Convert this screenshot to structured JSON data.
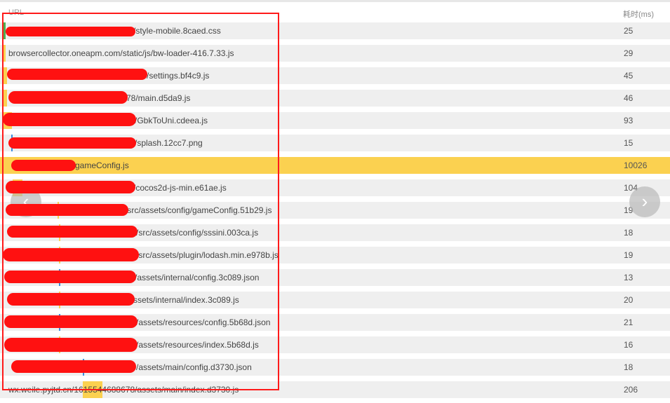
{
  "header": {
    "url_label": "URL",
    "time_label": "耗时(ms)"
  },
  "rows": [
    {
      "url": "/style-mobile.8caed.css",
      "ms": "25"
    },
    {
      "url": "browsercollector.oneapm.com/static/js/bw-loader-416.7.33.js",
      "ms": "29"
    },
    {
      "url": "/settings.bf4c9.js",
      "ms": "45"
    },
    {
      "url": "78/main.d5da9.js",
      "ms": "46"
    },
    {
      "url": "/GbkToUni.cdeea.js",
      "ms": "93"
    },
    {
      "url": "/splash.12cc7.png",
      "ms": "15"
    },
    {
      "url": "gameConfig.js",
      "ms": "10026"
    },
    {
      "url": "/cocos2d-js-min.e61ae.js",
      "ms": "104"
    },
    {
      "url": "/src/assets/config/gameConfig.51b29.js",
      "ms": "19"
    },
    {
      "url": "/src/assets/config/sssini.003ca.js",
      "ms": "18"
    },
    {
      "url": "/src/assets/plugin/lodash.min.e978b.js",
      "ms": "19"
    },
    {
      "url": "/assets/internal/config.3c089.json",
      "ms": "13"
    },
    {
      "url": "/assets/internal/index.3c089.js",
      "ms": "20"
    },
    {
      "url": "/assets/resources/config.5b68d.json",
      "ms": "21"
    },
    {
      "url": "/assets/resources/index.5b68d.js",
      "ms": "16"
    },
    {
      "url": "/assets/main/config.d3730.json",
      "ms": "18"
    },
    {
      "url": "wx.weile.pyjtd.cn/1615544688678/assets/main/index.d3730.js",
      "ms": "206"
    }
  ],
  "nav": {
    "prev_icon": "chevron-left-icon",
    "next_icon": "chevron-right-icon",
    "prev_glyph": "‹",
    "next_glyph": "›"
  },
  "colors": {
    "highlight": "#fbd150",
    "row_bg": "#efefef",
    "annotation": "#ff1111"
  }
}
